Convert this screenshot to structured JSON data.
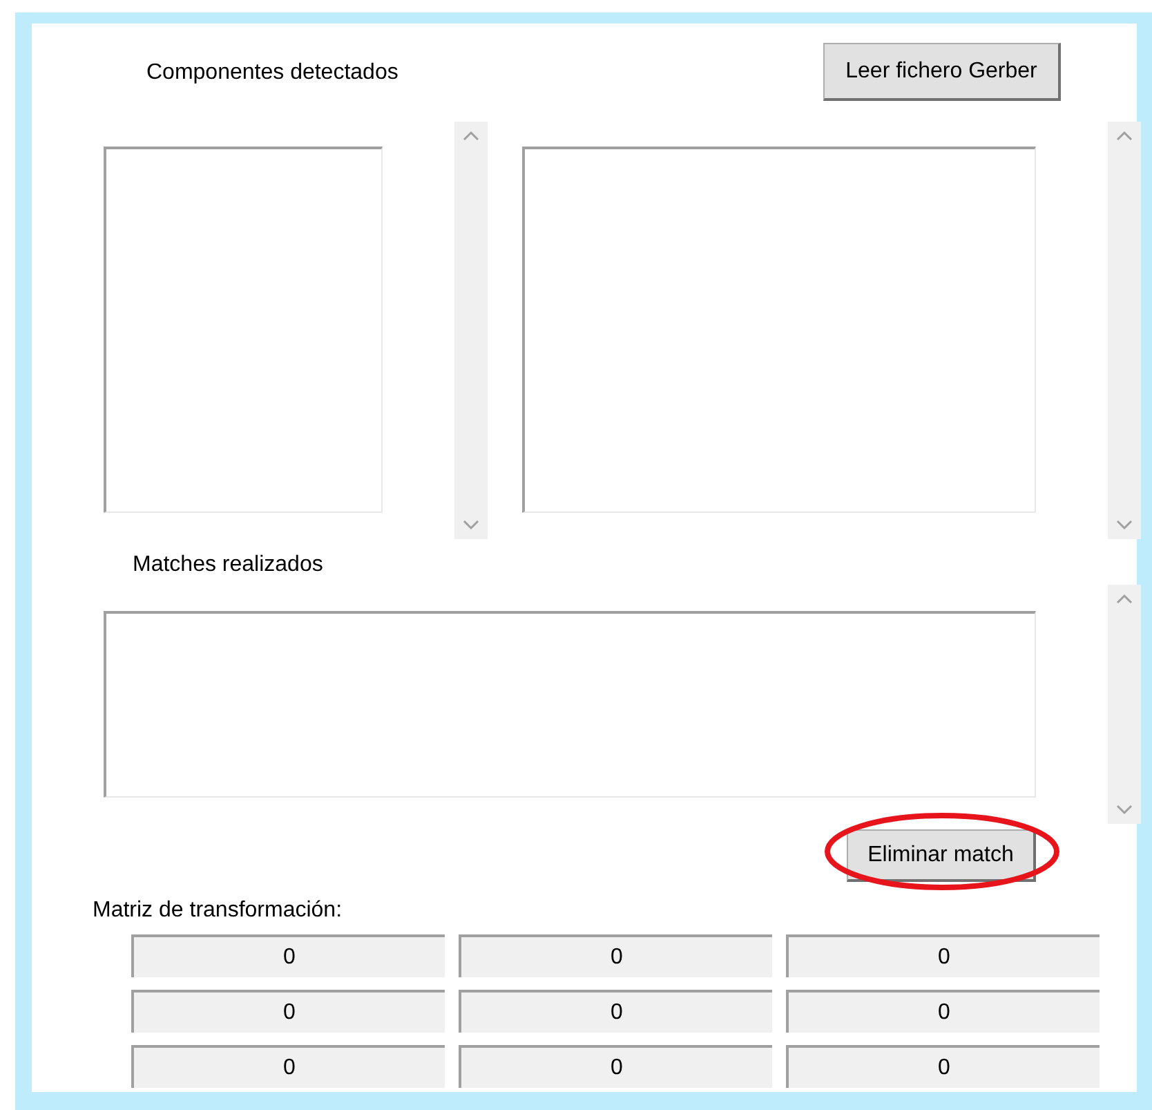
{
  "detected": {
    "label": "Componentes detectados",
    "button": "Leer fichero Gerber"
  },
  "matches": {
    "label": "Matches realizados",
    "button": "Eliminar match"
  },
  "matrix": {
    "label": "Matriz de transformación:",
    "rows": [
      [
        "0",
        "0",
        "0"
      ],
      [
        "0",
        "0",
        "0"
      ],
      [
        "0",
        "0",
        "0"
      ]
    ]
  }
}
